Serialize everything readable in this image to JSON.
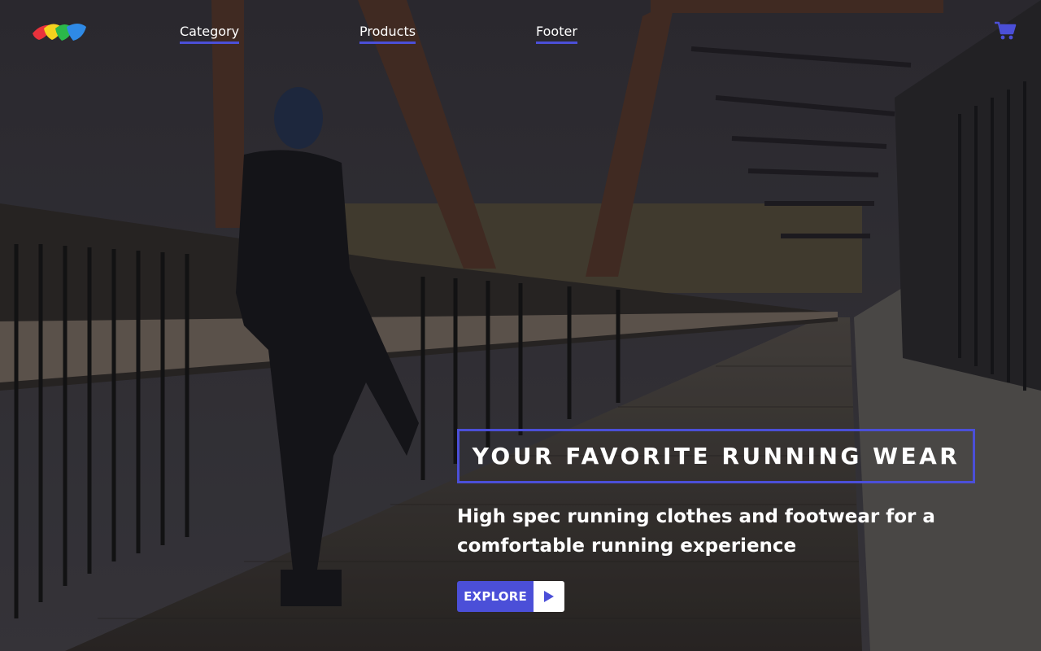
{
  "colors": {
    "accent": "#4b4fd8",
    "text": "#ffffff",
    "logo": [
      "#e8323c",
      "#f5d21e",
      "#2bb84a",
      "#2f8ae6"
    ]
  },
  "header": {
    "logo_icon": "logo-icon",
    "nav": [
      {
        "label": "Category"
      },
      {
        "label": "Products"
      },
      {
        "label": "Footer"
      }
    ],
    "cart_icon": "cart-icon"
  },
  "hero": {
    "title": "YOUR FAVORITE RUNNING WEAR",
    "subtitle": "High spec running clothes and footwear for a comfortable running experience",
    "cta": {
      "label": "EXPLORE",
      "icon": "play-icon"
    }
  }
}
